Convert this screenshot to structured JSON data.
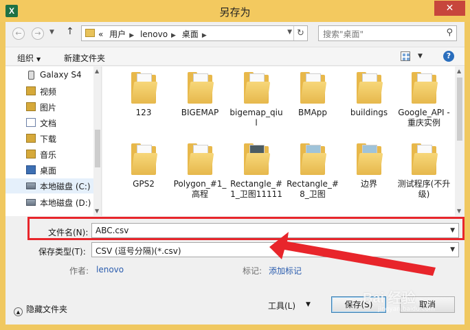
{
  "window": {
    "title": "另存为",
    "app_icon": "X",
    "close_glyph": "✕"
  },
  "nav": {
    "back_glyph": "←",
    "forward_glyph": "→",
    "up_glyph": "↑",
    "breadcrumb": [
      "«",
      "用户",
      "lenovo",
      "桌面"
    ],
    "refresh_glyph": "↻",
    "search_placeholder": "搜索\"桌面\""
  },
  "toolbar": {
    "organize": "组织",
    "new_folder": "新建文件夹",
    "help": "?"
  },
  "sidebar": {
    "items": [
      {
        "label": "Galaxy S4",
        "icon": "phone"
      },
      {
        "label": "视频",
        "icon": "lib"
      },
      {
        "label": "图片",
        "icon": "lib"
      },
      {
        "label": "文档",
        "icon": "doc"
      },
      {
        "label": "下载",
        "icon": "dl"
      },
      {
        "label": "音乐",
        "icon": "music"
      },
      {
        "label": "桌面",
        "icon": "desk"
      },
      {
        "label": "本地磁盘 (C:)",
        "icon": "drive"
      },
      {
        "label": "本地磁盘 (D:)",
        "icon": "drive"
      }
    ]
  },
  "files": [
    {
      "name": "123"
    },
    {
      "name": "BIGEMAP"
    },
    {
      "name": "bigemap_qiul"
    },
    {
      "name": "BMApp"
    },
    {
      "name": "buildings"
    },
    {
      "name": "Google_API - 重庆实例"
    },
    {
      "name": "GPS2"
    },
    {
      "name": "Polygon_#1_高程"
    },
    {
      "name": "Rectangle_#1_卫图11111"
    },
    {
      "name": "Rectangle_#8_卫图"
    },
    {
      "name": "边界"
    },
    {
      "name": "测试程序(不升级)"
    }
  ],
  "form": {
    "filename_label": "文件名(N):",
    "filename_value": "ABC.csv",
    "filetype_label": "保存类型(T):",
    "filetype_value": "CSV (逗号分隔)(*.csv)",
    "author_label": "作者:",
    "author_value": "lenovo",
    "tags_label": "标记:",
    "tags_value": "添加标记"
  },
  "footer": {
    "hide_folders": "隐藏文件夹",
    "tools": "工具(L)",
    "save": "保存(S)",
    "cancel": "取消"
  },
  "watermark": {
    "main": "Bai 经验",
    "sub": "jingyan.baidu.com"
  },
  "colors": {
    "titlebar": "#f3c95f",
    "highlight": "#e8252b",
    "link": "#2a5cae",
    "close": "#c7463c"
  }
}
